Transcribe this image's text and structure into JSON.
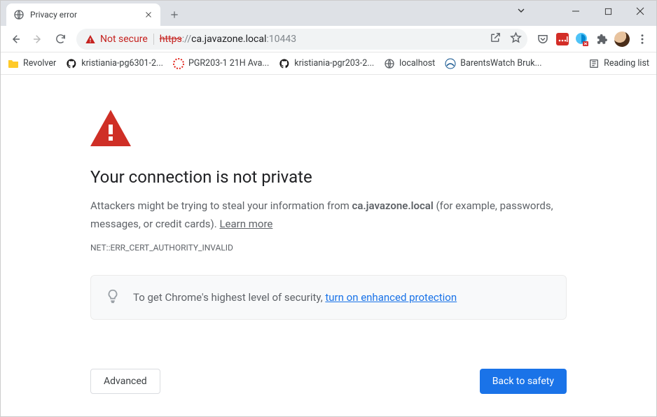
{
  "window": {
    "tab_title": "Privacy error"
  },
  "omnibox": {
    "security_label": "Not secure",
    "url_scheme": "https",
    "url_sep": "://",
    "url_host": "ca.javazone.local",
    "url_port": ":10443"
  },
  "bookmarks": [
    {
      "label": "Revolver",
      "icon": "folder"
    },
    {
      "label": "kristiania-pg6301-2...",
      "icon": "github"
    },
    {
      "label": "PGR203-1 21H Ava...",
      "icon": "canvas"
    },
    {
      "label": "kristiania-pgr203-2...",
      "icon": "github"
    },
    {
      "label": "localhost",
      "icon": "globe"
    },
    {
      "label": "BarentsWatch Bruk...",
      "icon": "bw"
    }
  ],
  "reading_list_label": "Reading list",
  "page": {
    "heading": "Your connection is not private",
    "desc_prefix": "Attackers might be trying to steal your information from ",
    "desc_host": "ca.javazone.local",
    "desc_suffix": " (for example, passwords, messages, or credit cards). ",
    "learn_more": "Learn more",
    "error_code": "NET::ERR_CERT_AUTHORITY_INVALID",
    "tip_prefix": "To get Chrome's highest level of security, ",
    "tip_link": "turn on enhanced protection",
    "advanced_label": "Advanced",
    "back_label": "Back to safety"
  }
}
